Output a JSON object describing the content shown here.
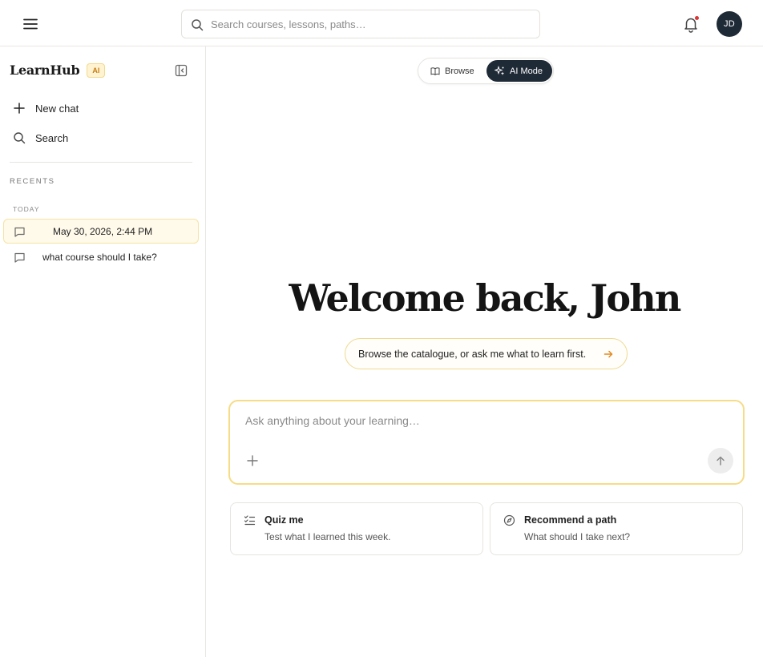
{
  "topbar": {
    "search_placeholder": "Search courses, lessons, paths…",
    "avatar_initials": "JD",
    "notification_dot_color": "#d93636"
  },
  "sidebar": {
    "brand": "LearnHub",
    "brand_badge": "AI",
    "actions": [
      {
        "label": "New chat",
        "icon": "plus-icon"
      },
      {
        "label": "Search",
        "icon": "search-icon"
      }
    ],
    "recents_title": "RECENTS",
    "groups": [
      {
        "title": "TODAY",
        "items": [
          {
            "label": "May 30, 2026, 2:44 PM",
            "active": true
          },
          {
            "label": "what course should I take?",
            "active": false
          }
        ]
      }
    ]
  },
  "mode_toggle": {
    "options": [
      {
        "label": "Browse",
        "icon": "book-icon",
        "selected": false
      },
      {
        "label": "AI Mode",
        "icon": "sparkle-icon",
        "selected": true
      }
    ]
  },
  "main": {
    "welcome": "Welcome back, John",
    "hint": "Browse the catalogue, or ask me what to learn first.",
    "composer_placeholder": "Ask anything about your learning…",
    "suggestions": [
      {
        "title": "Quiz me",
        "subtitle": "Test what I learned this week.",
        "icon": "checklist-icon"
      },
      {
        "title": "Recommend a path",
        "subtitle": "What should I take next?",
        "icon": "compass-icon"
      }
    ]
  },
  "colors": {
    "accent": "#f6dc86",
    "dark": "#1f2a37",
    "arrow": "#e08a1e"
  }
}
